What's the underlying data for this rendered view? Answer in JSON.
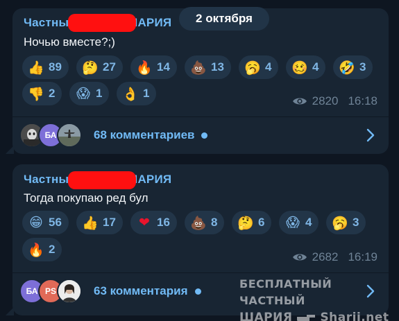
{
  "date_label": "2 октября",
  "posts": [
    {
      "sender_prefix": "Частны",
      "sender_suffix": "ШАРИЯ",
      "text": "Ночью вместе?;)",
      "reactions": [
        {
          "emoji": "thumbs-up",
          "glyph": "👍",
          "count": "89"
        },
        {
          "emoji": "thinking",
          "glyph": "🤔",
          "count": "27"
        },
        {
          "emoji": "fire",
          "glyph": "🔥",
          "count": "14"
        },
        {
          "emoji": "poop",
          "glyph": "💩",
          "count": "13"
        },
        {
          "emoji": "yawning",
          "glyph": "🥱",
          "count": "4"
        },
        {
          "emoji": "woozy",
          "glyph": "🥴",
          "count": "4"
        },
        {
          "emoji": "rofl",
          "glyph": "🤣",
          "count": "3"
        },
        {
          "emoji": "thumbs-down",
          "glyph": "👎",
          "count": "2"
        },
        {
          "emoji": "screaming",
          "glyph": "😱",
          "count": "1"
        },
        {
          "emoji": "ok-hand",
          "glyph": "👌",
          "count": "1"
        }
      ],
      "views": "2820",
      "time": "16:18",
      "comments": {
        "label": "68 комментариев",
        "avatars": [
          {
            "type": "photo",
            "initials": ""
          },
          {
            "type": "initials",
            "initials": "БА",
            "color": "#7d6fd8"
          },
          {
            "type": "photo",
            "initials": ""
          }
        ]
      }
    },
    {
      "sender_prefix": "Частны",
      "sender_suffix": "ШАРИЯ",
      "text": "Тогда покупаю ред бул",
      "reactions": [
        {
          "emoji": "grinning",
          "glyph": "😁",
          "count": "56"
        },
        {
          "emoji": "thumbs-up",
          "glyph": "👍",
          "count": "17"
        },
        {
          "emoji": "heart",
          "glyph": "❤",
          "count": "16"
        },
        {
          "emoji": "poop",
          "glyph": "💩",
          "count": "8"
        },
        {
          "emoji": "thinking",
          "glyph": "🤔",
          "count": "6"
        },
        {
          "emoji": "screaming",
          "glyph": "😱",
          "count": "4"
        },
        {
          "emoji": "yawning",
          "glyph": "🥱",
          "count": "3"
        },
        {
          "emoji": "fire",
          "glyph": "🔥",
          "count": "2"
        }
      ],
      "views": "2682",
      "time": "16:19",
      "comments": {
        "label": "63 комментария",
        "avatars": [
          {
            "type": "initials",
            "initials": "БА",
            "color": "#7d6fd8"
          },
          {
            "type": "initials",
            "initials": "PS",
            "color": "#e16a58"
          },
          {
            "type": "photo",
            "initials": ""
          }
        ]
      }
    }
  ],
  "watermark": {
    "line1": "БЕСПЛАТНЫЙ ЧАСТНЫЙ",
    "line2_left": "ШАРИЯ",
    "line2_right": "Sharij.net"
  },
  "colors": {
    "background": "#0e1621",
    "bubble": "#182533",
    "accent": "#71baf5",
    "reaction_bg": "#223548",
    "redaction": "#ff1010"
  }
}
